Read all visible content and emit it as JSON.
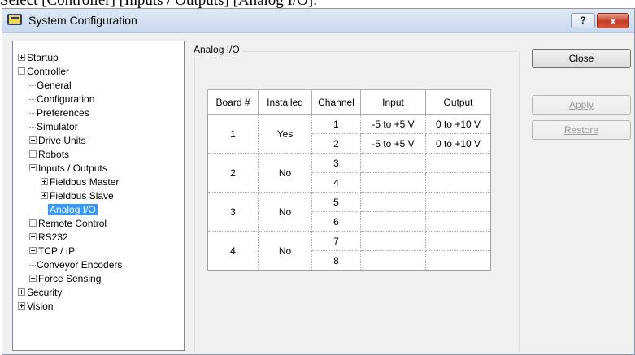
{
  "caption": "Select [Controller] [Inputs / Outputs] [Analog I/O].",
  "window": {
    "title": "System Configuration",
    "help_label": "?",
    "close_glyph": "x"
  },
  "tree": [
    {
      "label": "Startup",
      "expander": "plus",
      "level": 0
    },
    {
      "label": "Controller",
      "expander": "minus",
      "level": 0
    },
    {
      "label": "General",
      "expander": "none",
      "level": 1
    },
    {
      "label": "Configuration",
      "expander": "none",
      "level": 1
    },
    {
      "label": "Preferences",
      "expander": "none",
      "level": 1
    },
    {
      "label": "Simulator",
      "expander": "none",
      "level": 1
    },
    {
      "label": "Drive Units",
      "expander": "plus",
      "level": 1
    },
    {
      "label": "Robots",
      "expander": "plus",
      "level": 1
    },
    {
      "label": "Inputs / Outputs",
      "expander": "minus",
      "level": 1
    },
    {
      "label": "Fieldbus Master",
      "expander": "plus",
      "level": 2
    },
    {
      "label": "Fieldbus Slave",
      "expander": "plus",
      "level": 2
    },
    {
      "label": "Analog I/O",
      "expander": "none",
      "level": 2,
      "selected": true
    },
    {
      "label": "Remote Control",
      "expander": "plus",
      "level": 1
    },
    {
      "label": "RS232",
      "expander": "plus",
      "level": 1
    },
    {
      "label": "TCP / IP",
      "expander": "plus",
      "level": 1
    },
    {
      "label": "Conveyor Encoders",
      "expander": "none",
      "level": 1
    },
    {
      "label": "Force Sensing",
      "expander": "plus",
      "level": 1
    },
    {
      "label": "Security",
      "expander": "plus",
      "level": 0
    },
    {
      "label": "Vision",
      "expander": "plus",
      "level": 0
    }
  ],
  "group_title": "Analog I/O",
  "table": {
    "headers": [
      "Board #",
      "Installed",
      "Channel",
      "Input",
      "Output"
    ],
    "boards": [
      {
        "board": "1",
        "installed": "Yes",
        "channels": [
          {
            "channel": "1",
            "input": "-5 to +5 V",
            "output": "0 to +10 V"
          },
          {
            "channel": "2",
            "input": "-5 to +5 V",
            "output": "0 to +10 V"
          }
        ]
      },
      {
        "board": "2",
        "installed": "No",
        "channels": [
          {
            "channel": "3",
            "input": "",
            "output": ""
          },
          {
            "channel": "4",
            "input": "",
            "output": ""
          }
        ]
      },
      {
        "board": "3",
        "installed": "No",
        "channels": [
          {
            "channel": "5",
            "input": "",
            "output": ""
          },
          {
            "channel": "6",
            "input": "",
            "output": ""
          }
        ]
      },
      {
        "board": "4",
        "installed": "No",
        "channels": [
          {
            "channel": "7",
            "input": "",
            "output": ""
          },
          {
            "channel": "8",
            "input": "",
            "output": ""
          }
        ]
      }
    ]
  },
  "buttons": {
    "close": "Close",
    "apply": "Apply",
    "restore": "Restore"
  }
}
